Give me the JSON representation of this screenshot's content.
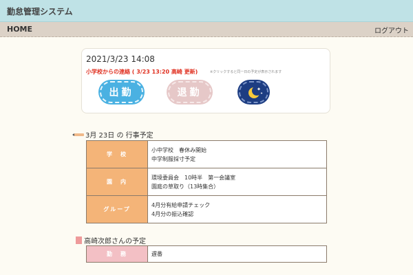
{
  "app": {
    "title": "勤怠管理システム"
  },
  "nav": {
    "home": "HOME",
    "logout": "ログアウト"
  },
  "clock_card": {
    "datetime": "2021/3/23 14:08",
    "notice": "小学校からの連絡 ( 3/23 13:20 高崎 更新)",
    "notice_hint": "※クリックすると同一日の予定が表示されます",
    "clock_in_label": "出勤",
    "clock_out_label": "退勤",
    "night_icon": "moon-stars-icon"
  },
  "events": {
    "title": "3月 23日 の 行事予定",
    "rows": [
      {
        "head": "学　校",
        "lines": [
          "小中学校　春休み開始",
          "中学制服採寸予定"
        ]
      },
      {
        "head": "園　内",
        "lines": [
          "環境委員会　10時半　第一会議室",
          "園庭の草取り（13時集合）"
        ]
      },
      {
        "head": "グループ",
        "lines": [
          "4月分有給申請チェック",
          "4月分の振込確認"
        ]
      }
    ]
  },
  "person": {
    "title": "高崎次郎さんの予定",
    "rows": [
      {
        "head": "勤　務",
        "value": "遅番"
      }
    ]
  },
  "colors": {
    "header": "#bfe2e6",
    "nav": "#dcd2c7",
    "clock_in": "#4ab1e2",
    "clock_out": "#e6c8c8",
    "night": "#1d3d82",
    "event_head": "#f4b478",
    "person_head": "#f3c0c5",
    "notice": "#e03020"
  }
}
